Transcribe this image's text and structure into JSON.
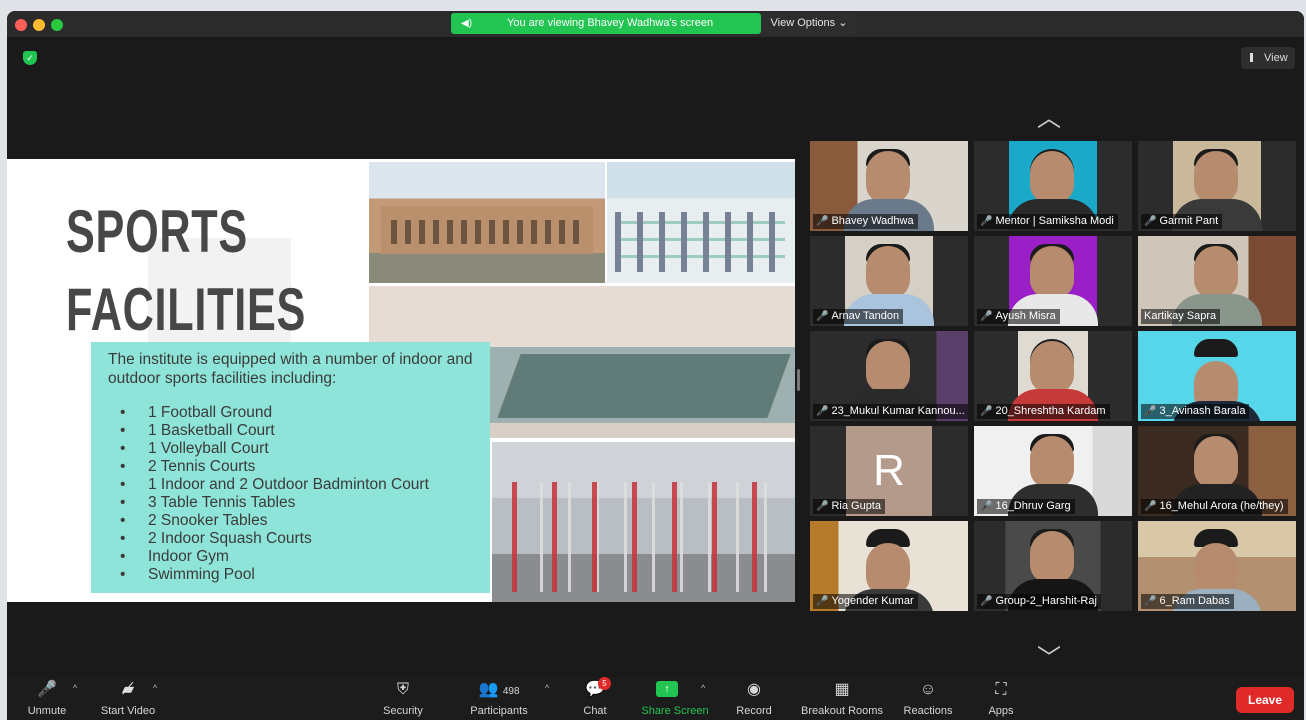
{
  "meeting": {
    "banner_text": "You are viewing Bhavey Wadhwa's screen",
    "view_options": "View Options",
    "view_button": "View"
  },
  "slide": {
    "title_line1": "SPORTS",
    "title_line2": "FACILITIES",
    "intro": "The institute is equipped with a number of indoor and outdoor sports facilities including:",
    "facilities": [
      "1 Football Ground",
      "1 Basketball Court",
      "1 Volleyball Court",
      "2 Tennis Courts",
      "1 Indoor and 2 Outdoor Badminton Court",
      "3 Table Tennis Tables",
      "2 Snooker Tables",
      "2 Indoor Squash Courts",
      "Indoor Gym",
      "Swimming Pool"
    ]
  },
  "participants_gallery": [
    {
      "name": "Bhavey Wadhwa"
    },
    {
      "name": "Mentor | Samiksha Modi"
    },
    {
      "name": "Garmit Pant"
    },
    {
      "name": "Arnav Tandon"
    },
    {
      "name": "Ayush Misra"
    },
    {
      "name": "Kartikay Sapra"
    },
    {
      "name": "23_Mukul Kumar Kannou..."
    },
    {
      "name": "20_Shreshtha Kardam"
    },
    {
      "name": "3_Avinash Barala"
    },
    {
      "name": "Ria Gupta",
      "avatar_letter": "R"
    },
    {
      "name": "16_Dhruv Garg"
    },
    {
      "name": "16_Mehul Arora  (he/they)"
    },
    {
      "name": "Yogender Kumar"
    },
    {
      "name": "Group-2_Harshit-Raj"
    },
    {
      "name": "6_Ram Dabas"
    }
  ],
  "toolbar": {
    "unmute": "Unmute",
    "start_video": "Start Video",
    "security": "Security",
    "participants": "Participants",
    "participants_count": "498",
    "chat": "Chat",
    "chat_badge": "5",
    "share_screen": "Share Screen",
    "record": "Record",
    "breakout_rooms": "Breakout Rooms",
    "reactions": "Reactions",
    "apps": "Apps",
    "leave": "Leave"
  }
}
